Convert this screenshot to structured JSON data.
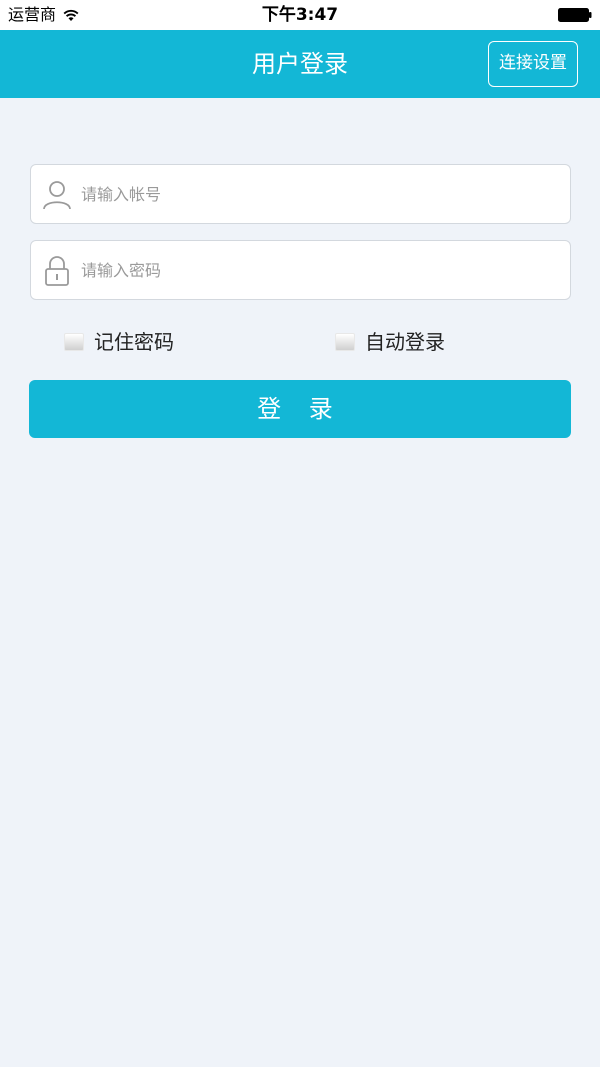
{
  "status_bar": {
    "carrier": "运营商",
    "time": "下午3:47"
  },
  "nav": {
    "title": "用户登录",
    "connection_settings_label": "连接设置"
  },
  "form": {
    "account_placeholder": "请输入帐号",
    "password_placeholder": "请输入密码",
    "remember_password_label": "记住密码",
    "auto_login_label": "自动登录",
    "login_button_label": "登 录"
  },
  "icons": {
    "account": "user-icon",
    "password": "lock-icon",
    "wifi": "wifi-icon",
    "battery": "battery-icon"
  },
  "colors": {
    "accent": "#13b7d6",
    "background": "#eff3f9"
  }
}
